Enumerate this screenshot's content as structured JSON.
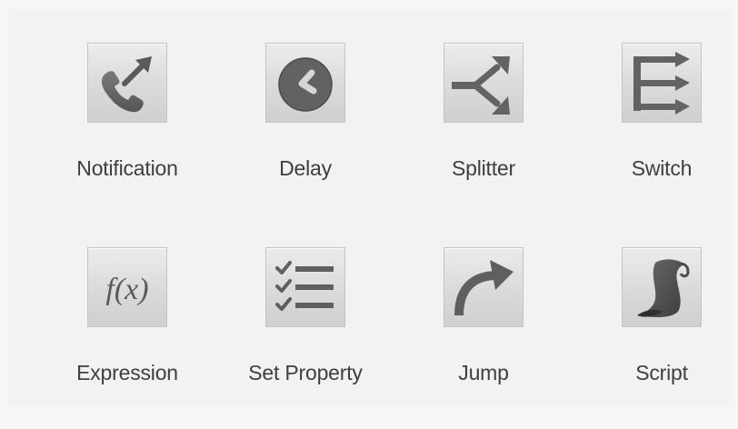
{
  "tiles": [
    {
      "label": "Notification",
      "icon": "phone-call-icon"
    },
    {
      "label": "Delay",
      "icon": "clock-icon"
    },
    {
      "label": "Splitter",
      "icon": "split-arrows-icon"
    },
    {
      "label": "Switch",
      "icon": "switch-branches-icon"
    },
    {
      "label": "Expression",
      "icon": "function-icon",
      "glyph": "f(x)"
    },
    {
      "label": "Set Property",
      "icon": "checklist-icon"
    },
    {
      "label": "Jump",
      "icon": "curved-arrow-icon"
    },
    {
      "label": "Script",
      "icon": "scroll-icon"
    }
  ],
  "colors": {
    "background": "#f6f6f6",
    "tile_light": "#ececec",
    "tile_dark": "#cfcfcf",
    "icon_gray": "#6b6b6b",
    "label_text": "#3f3f3f"
  }
}
